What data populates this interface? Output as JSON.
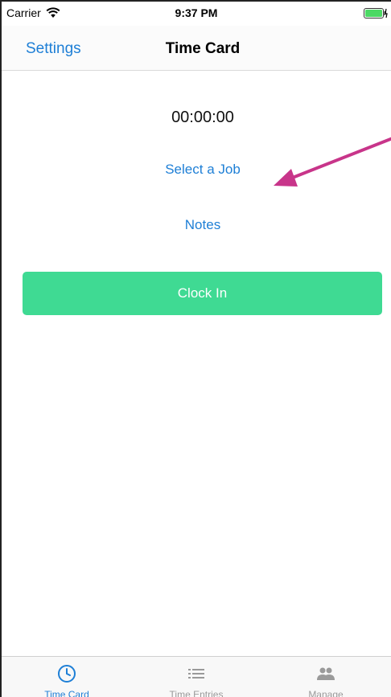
{
  "status_bar": {
    "carrier": "Carrier",
    "time": "9:37 PM",
    "wifi_icon": "wifi-icon",
    "battery_icon": "battery-charging-icon",
    "battery_color": "#4cd964"
  },
  "nav_bar": {
    "left_button": "Settings",
    "title": "Time Card"
  },
  "main": {
    "timer": "00:00:00",
    "select_job": "Select a Job",
    "notes": "Notes",
    "clock_in": "Clock In"
  },
  "tabs": [
    {
      "label": "Time Card",
      "icon": "clock-icon",
      "active": true
    },
    {
      "label": "Time Entries",
      "icon": "list-icon",
      "active": false
    },
    {
      "label": "Manage",
      "icon": "people-icon",
      "active": false
    }
  ],
  "colors": {
    "accent": "#1e7fd6",
    "clock_in_button": "#3fda93",
    "annotation_arrow": "#c8358a"
  }
}
